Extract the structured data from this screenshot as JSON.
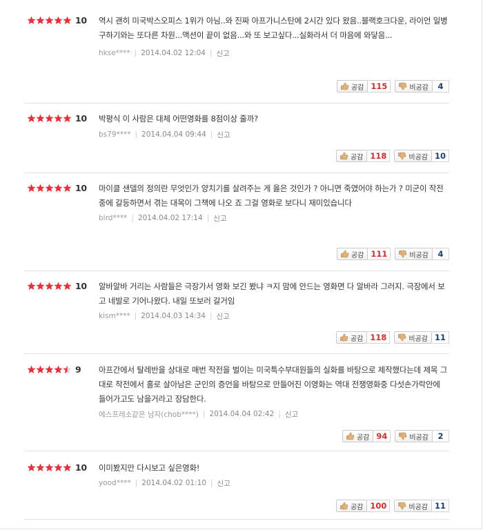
{
  "colors": {
    "star_filled": "#e8303a",
    "star_empty": "#d6d6d6",
    "sympathy_count": "#c9302c",
    "unsympathy_count": "#1d3e71"
  },
  "reviews": [
    {
      "score": "10",
      "stars": 5,
      "text": "역시 괜히 미국박스오피스 1위가 아님..와 진짜 아프가니스탄에 2시간 있다 왔음..블랙호크다운, 라이언 일병 구하기와는 또다른 차원...액션이 끝이 없음...와 또 보고싶다...실화라서 더 마음에 와닿음...",
      "author": "hkse****",
      "date": "2014.04.02 12:04",
      "report": "신고",
      "like_label": "공감",
      "like_count": "115",
      "dislike_label": "비공감",
      "dislike_count": "4"
    },
    {
      "score": "10",
      "stars": 5,
      "text": "박평식 이 사람은 대체 어떤영화를 8점이상 줄까?",
      "author": "bs79****",
      "date": "2014.04.04 09:44",
      "report": "신고",
      "like_label": "공감",
      "like_count": "118",
      "dislike_label": "비공감",
      "dislike_count": "10"
    },
    {
      "score": "10",
      "stars": 5,
      "text": "마이클 샌델의 정의란 무엇인가 양치기를 살려주는 게 옳은 것인가 ? 아니면 죽였어야 하는가 ? 미군이 작전중에 갈등하면서 겪는 대목이 그책에 나오 죠 그걸 영화로 보다니 재미있습니다",
      "author": "bird****",
      "date": "2014.04.02 17:14",
      "report": "신고",
      "like_label": "공감",
      "like_count": "111",
      "dislike_label": "비공감",
      "dislike_count": "4"
    },
    {
      "score": "10",
      "stars": 5,
      "text": "알바알바 거리는 사람들은 극장가서 영화 보긴 봤냐 ㅋ지 맘에 안드는 영화면 다 알바라 그러지. 극장에서 보고 네발로 기어나왔다. 내일 또보러 갈거임",
      "author": "kism****",
      "date": "2014.04.03 14:34",
      "report": "신고",
      "like_label": "공감",
      "like_count": "118",
      "dislike_label": "비공감",
      "dislike_count": "11"
    },
    {
      "score": "9",
      "stars": 4.5,
      "text": "아프간에서 탈레반을 상대로 매번 작전을 벌이는 미국특수부대원들의 실화를 바탕으로 제작했다는데 제목 그대로 작전에서 홀로 살아남은 군인의 증언을 바탕으로 만들어진 이영화는 역대 전쟁영화중 다섯손가락안에 들어가고도 남을거라고 장담한다.",
      "author": "에스프레소같은 남자(chob****)",
      "date": "2014.04.04 02:42",
      "report": "신고",
      "like_label": "공감",
      "like_count": "94",
      "dislike_label": "비공감",
      "dislike_count": "2"
    },
    {
      "score": "10",
      "stars": 5,
      "text": "이미봤지만 다시보고 싶은영화!",
      "author": "yood****",
      "date": "2014.04.02 01:10",
      "report": "신고",
      "like_label": "공감",
      "like_count": "100",
      "dislike_label": "비공감",
      "dislike_count": "11"
    }
  ]
}
